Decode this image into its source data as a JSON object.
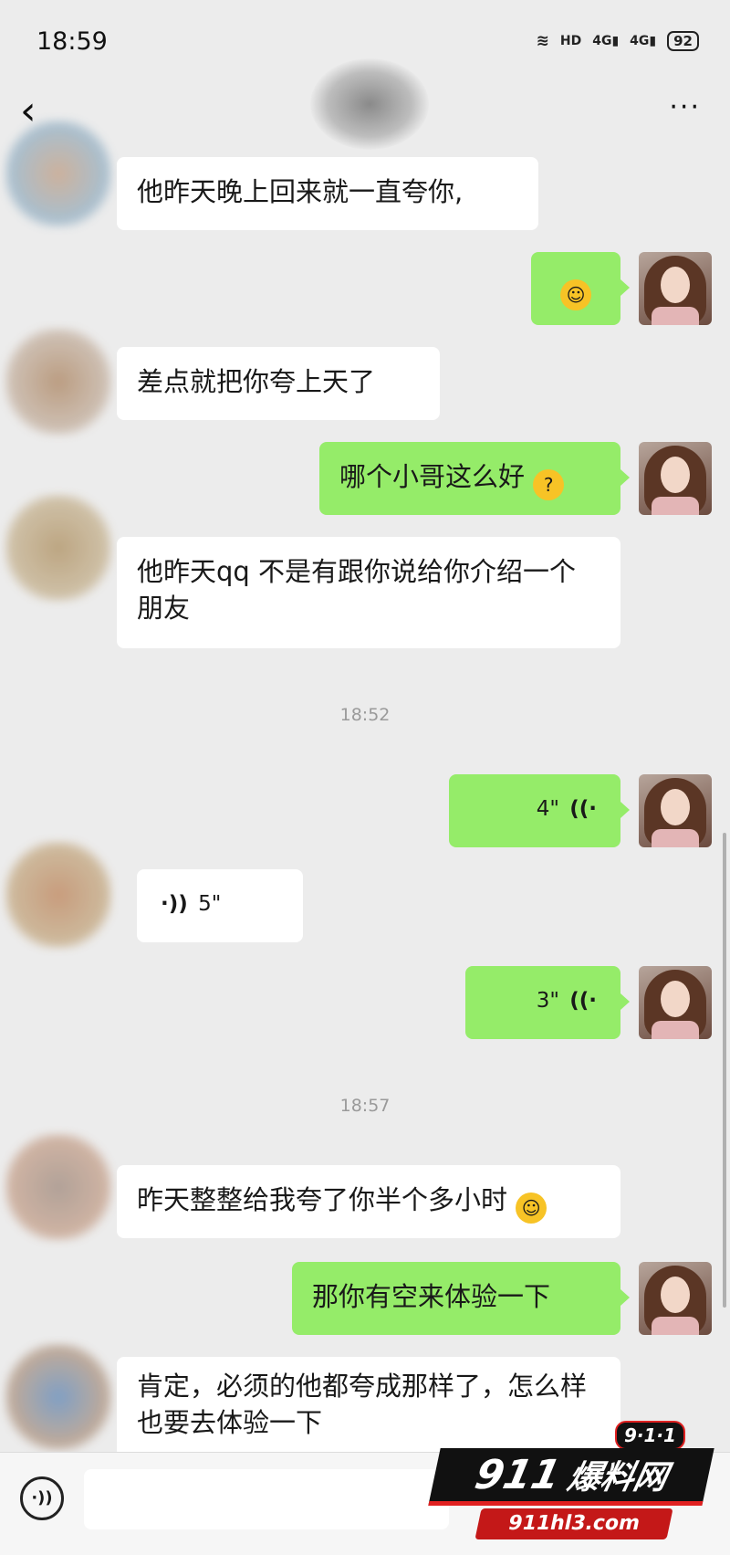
{
  "status_bar": {
    "time": "18:59",
    "hd_label": "HD",
    "sig1": "4G",
    "sig2": "4G",
    "battery": "92"
  },
  "header": {
    "back_icon": "chevron-left-icon",
    "more_icon": "more-dots-icon",
    "more_glyph": "···"
  },
  "messages": [
    {
      "side": "in",
      "text": "他昨天晚上回来就一直夸你,"
    },
    {
      "side": "out",
      "text": "",
      "emoji": "grin-emoji"
    },
    {
      "side": "in",
      "text": "差点就把你夸上天了"
    },
    {
      "side": "out",
      "text": "哪个小哥这么好",
      "emoji": "thinking-emoji"
    },
    {
      "side": "in",
      "text": "他昨天qq 不是有跟你说给你介绍一个朋友"
    },
    {
      "side": "time",
      "text": "18:52"
    },
    {
      "side": "out",
      "voice_seconds": "4\""
    },
    {
      "side": "in",
      "voice_seconds": "5\""
    },
    {
      "side": "out",
      "voice_seconds": "3\""
    },
    {
      "side": "time",
      "text": "18:57"
    },
    {
      "side": "in",
      "text": "昨天整整给我夸了你半个多小时",
      "emoji": "grin-emoji"
    },
    {
      "side": "out",
      "text": "那你有空来体验一下"
    },
    {
      "side": "in",
      "text": "肯定，必须的他都夸成那样了，怎么样也要去体验一下"
    }
  ],
  "bottom_bar": {
    "voice_icon": "voice-toggle-icon"
  },
  "watermark": {
    "badge": "9·1·1",
    "number": "911",
    "name": "爆料网",
    "url": "911hl3.com"
  },
  "colors": {
    "outgoing": "#95ec69",
    "incoming": "#ffffff",
    "background": "#ececec",
    "watermark_red": "#e02020"
  }
}
